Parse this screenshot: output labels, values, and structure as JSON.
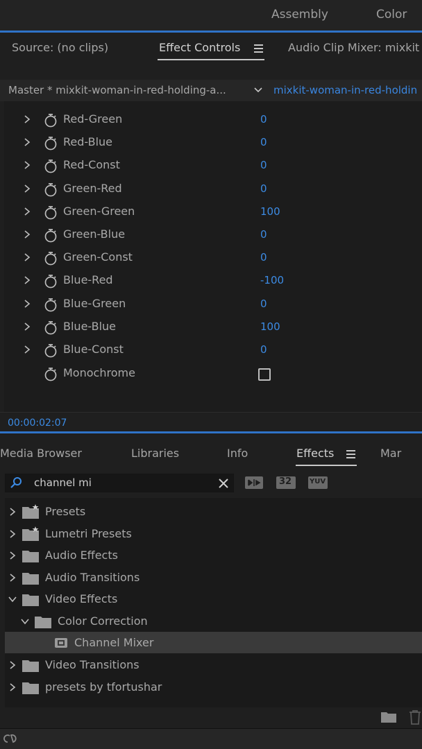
{
  "workspaces": [
    "Assembly",
    "Color"
  ],
  "top_tabs": {
    "source": "Source: (no clips)",
    "effect_controls": "Effect Controls",
    "audio_clip_mixer": "Audio Clip Mixer: mixkit"
  },
  "master": {
    "label": "Master * mixkit-woman-in-red-holding-a...",
    "clip": "mixkit-woman-in-red-holdin"
  },
  "params": [
    {
      "name": "Red-Green",
      "value": "0"
    },
    {
      "name": "Red-Blue",
      "value": "0"
    },
    {
      "name": "Red-Const",
      "value": "0"
    },
    {
      "name": "Green-Red",
      "value": "0"
    },
    {
      "name": "Green-Green",
      "value": "100"
    },
    {
      "name": "Green-Blue",
      "value": "0"
    },
    {
      "name": "Green-Const",
      "value": "0"
    },
    {
      "name": "Blue-Red",
      "value": "-100"
    },
    {
      "name": "Blue-Green",
      "value": "0"
    },
    {
      "name": "Blue-Blue",
      "value": "100"
    },
    {
      "name": "Blue-Const",
      "value": "0"
    }
  ],
  "monochrome": {
    "name": "Monochrome",
    "checked": false
  },
  "timecode": "00:00:02:07",
  "bottom_tabs": {
    "media_browser": "Media Browser",
    "libraries": "Libraries",
    "info": "Info",
    "effects": "Effects",
    "markers": "Mar"
  },
  "search": {
    "value": "channel mi"
  },
  "fx_buttons": [
    "32",
    "YUV"
  ],
  "tree": [
    {
      "label": "Presets",
      "level": 0,
      "expanded": false,
      "icon": "preset-folder-icon"
    },
    {
      "label": "Lumetri Presets",
      "level": 0,
      "expanded": false,
      "icon": "preset-folder-icon"
    },
    {
      "label": "Audio Effects",
      "level": 0,
      "expanded": false,
      "icon": "folder-icon"
    },
    {
      "label": "Audio Transitions",
      "level": 0,
      "expanded": false,
      "icon": "folder-icon"
    },
    {
      "label": "Video Effects",
      "level": 0,
      "expanded": true,
      "icon": "folder-icon"
    },
    {
      "label": "Color Correction",
      "level": 1,
      "expanded": true,
      "icon": "folder-icon"
    },
    {
      "label": "Channel Mixer",
      "level": 2,
      "selected": true,
      "icon": "effect-icon"
    },
    {
      "label": "Video Transitions",
      "level": 0,
      "expanded": false,
      "icon": "folder-icon"
    },
    {
      "label": "presets by tfortushar",
      "level": 0,
      "expanded": false,
      "icon": "folder-icon"
    }
  ],
  "colors": {
    "accent_blue": "#2f73c8",
    "value_blue": "#3c8be4",
    "selected_row": "#3a3a3a"
  }
}
